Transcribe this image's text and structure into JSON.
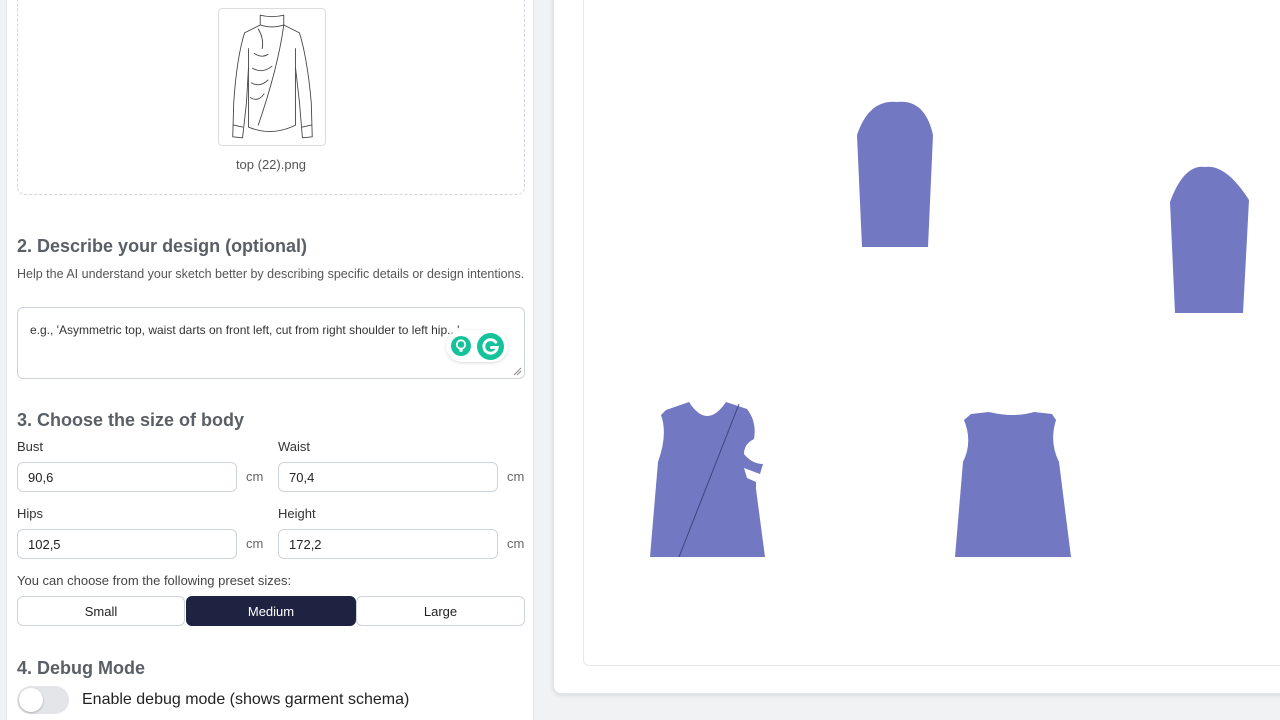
{
  "upload": {
    "filename": "top (22).png"
  },
  "describe": {
    "heading": "2. Describe your design (optional)",
    "help": "Help the AI understand your sketch better by describing specific details or design intentions.",
    "placeholder": "e.g., 'Asymmetric top, waist darts on front left, cut from right shoulder to left hip...'"
  },
  "size": {
    "heading": "3. Choose the size of body",
    "fields": {
      "bust": {
        "label": "Bust",
        "value": "90,6",
        "unit": "cm"
      },
      "waist": {
        "label": "Waist",
        "value": "70,4",
        "unit": "cm"
      },
      "hips": {
        "label": "Hips",
        "value": "102,5",
        "unit": "cm"
      },
      "height": {
        "label": "Height",
        "value": "172,2",
        "unit": "cm"
      }
    },
    "presets_label": "You can choose from the following preset sizes:",
    "presets": [
      "Small",
      "Medium",
      "Large"
    ],
    "selected_preset": "Medium"
  },
  "debug": {
    "heading": "4. Debug Mode",
    "toggle_label": "Enable debug mode (shows garment schema)",
    "enabled": false
  },
  "colors": {
    "pattern_fill": "#7278c2",
    "active_button": "#1d2340"
  }
}
